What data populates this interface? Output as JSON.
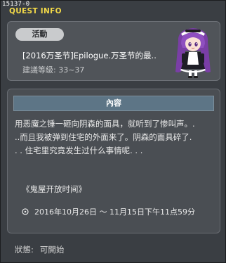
{
  "window": {
    "id": "15137-0",
    "title": "QUEST INFO"
  },
  "quest": {
    "badge": "活動",
    "title": "[2016万圣节]Epilogue.万圣节的最..",
    "level": "建議等級: 33~37",
    "portrait_icon": "npc-portrait-icon"
  },
  "content": {
    "header": "內容",
    "lines": [
      "用恶魔之锤一砸向阴森的面具，就听到了惨叫声。.",
      "..而且我被弹到住宅的外面来了。阴森的面具碎了.",
      ". . 住宅里究竟发生过什么事情呢. . ."
    ],
    "subheading": "《鬼屋开放时间》",
    "period_icon": "clock-icon",
    "period": "2016年10月26日 ～ 11月15日下午11点59分"
  },
  "status": {
    "label": "狀態:",
    "value": "可開始"
  },
  "colors": {
    "title_yellow": "#f1d848",
    "content_header_bg": "#5d7586",
    "badge_bg": "#c9cbcd"
  }
}
